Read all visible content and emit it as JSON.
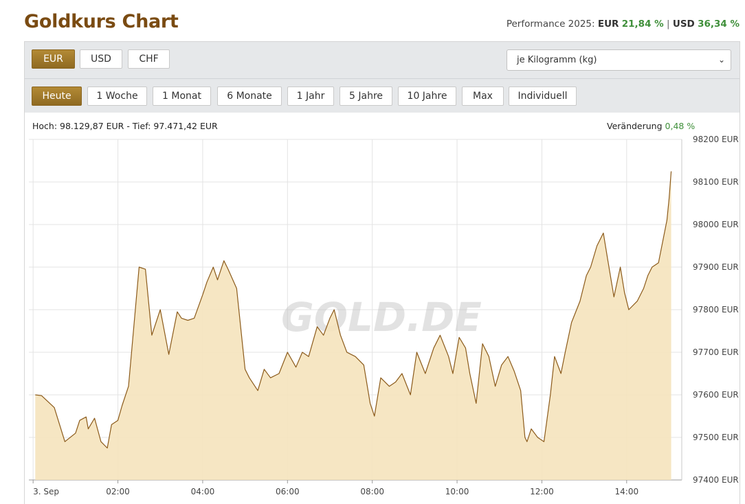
{
  "page": {
    "title": "Goldkurs Chart",
    "performance": {
      "label": "Performance 2025:",
      "eur_label": "EUR",
      "eur_value": "21,84 %",
      "separator": "|",
      "usd_label": "USD",
      "usd_value": "36,34 %"
    }
  },
  "controls": {
    "currencies": [
      {
        "label": "EUR",
        "active": true
      },
      {
        "label": "USD",
        "active": false
      },
      {
        "label": "CHF",
        "active": false
      }
    ],
    "unit_select": {
      "value": "je Kilogramm (kg)"
    },
    "ranges": [
      {
        "label": "Heute",
        "active": true
      },
      {
        "label": "1 Woche",
        "active": false
      },
      {
        "label": "1 Monat",
        "active": false
      },
      {
        "label": "6 Monate",
        "active": false
      },
      {
        "label": "1 Jahr",
        "active": false
      },
      {
        "label": "5 Jahre",
        "active": false
      },
      {
        "label": "10 Jahre",
        "active": false
      },
      {
        "label": "Max",
        "active": false
      },
      {
        "label": "Individuell",
        "active": false
      }
    ]
  },
  "stats": {
    "high_low": "Hoch: 98.129,87 EUR - Tief: 97.471,42 EUR",
    "change_label": "Veränderung",
    "change_value": "0,48 %"
  },
  "watermark": "GOLD.DE",
  "colors": {
    "accent": "#9c7428",
    "title": "#7a4b12",
    "positive": "#3f8f3a",
    "area_fill": "#f5e3bd",
    "line": "#8b5a1a"
  },
  "chart_data": {
    "type": "area",
    "x_unit": "hours",
    "x_ticks": [
      {
        "t": 0,
        "label": "3. Sep"
      },
      {
        "t": 2,
        "label": "02:00"
      },
      {
        "t": 4,
        "label": "04:00"
      },
      {
        "t": 6,
        "label": "06:00"
      },
      {
        "t": 8,
        "label": "08:00"
      },
      {
        "t": 10,
        "label": "10:00"
      },
      {
        "t": 12,
        "label": "12:00"
      },
      {
        "t": 14,
        "label": "14:00"
      }
    ],
    "y_ticks": [
      97400,
      97500,
      97600,
      97700,
      97800,
      97900,
      98000,
      98100,
      98200
    ],
    "y_tick_suffix": " EUR",
    "xlim": [
      -0.1,
      15.3
    ],
    "ylim": [
      97400,
      98200
    ],
    "grid": true,
    "x": [
      0.05,
      0.2,
      0.5,
      0.75,
      1.0,
      1.1,
      1.25,
      1.3,
      1.45,
      1.6,
      1.75,
      1.85,
      2.0,
      2.1,
      2.25,
      2.5,
      2.65,
      2.8,
      3.0,
      3.2,
      3.4,
      3.5,
      3.65,
      3.8,
      4.0,
      4.1,
      4.25,
      4.35,
      4.5,
      4.6,
      4.8,
      5.0,
      5.1,
      5.3,
      5.45,
      5.6,
      5.8,
      6.0,
      6.2,
      6.35,
      6.5,
      6.7,
      6.85,
      7.0,
      7.1,
      7.25,
      7.4,
      7.6,
      7.8,
      7.95,
      8.05,
      8.2,
      8.4,
      8.55,
      8.7,
      8.9,
      9.05,
      9.25,
      9.45,
      9.6,
      9.8,
      9.9,
      10.05,
      10.2,
      10.3,
      10.45,
      10.6,
      10.75,
      10.9,
      11.05,
      11.2,
      11.35,
      11.5,
      11.6,
      11.65,
      11.75,
      11.9,
      12.05,
      12.2,
      12.3,
      12.45,
      12.55,
      12.7,
      12.9,
      13.05,
      13.15,
      13.3,
      13.45,
      13.55,
      13.7,
      13.85,
      13.95,
      14.05,
      14.25,
      14.4,
      14.5,
      14.6,
      14.75,
      14.95,
      15.0,
      15.05
    ],
    "values": [
      97600,
      97598,
      97570,
      97490,
      97510,
      97540,
      97548,
      97520,
      97545,
      97490,
      97475,
      97530,
      97540,
      97575,
      97620,
      97900,
      97895,
      97740,
      97800,
      97695,
      97795,
      97780,
      97775,
      97780,
      97835,
      97865,
      97900,
      97870,
      97915,
      97895,
      97850,
      97660,
      97640,
      97610,
      97660,
      97640,
      97650,
      97700,
      97665,
      97700,
      97690,
      97760,
      97740,
      97780,
      97800,
      97740,
      97700,
      97690,
      97670,
      97580,
      97550,
      97640,
      97620,
      97630,
      97650,
      97600,
      97700,
      97650,
      97710,
      97740,
      97690,
      97650,
      97735,
      97710,
      97650,
      97580,
      97720,
      97690,
      97620,
      97670,
      97690,
      97655,
      97610,
      97500,
      97490,
      97520,
      97500,
      97490,
      97600,
      97690,
      97650,
      97700,
      97770,
      97820,
      97880,
      97900,
      97950,
      97980,
      97920,
      97830,
      97900,
      97840,
      97800,
      97820,
      97850,
      97880,
      97900,
      97910,
      98010,
      98060,
      98125
    ]
  }
}
